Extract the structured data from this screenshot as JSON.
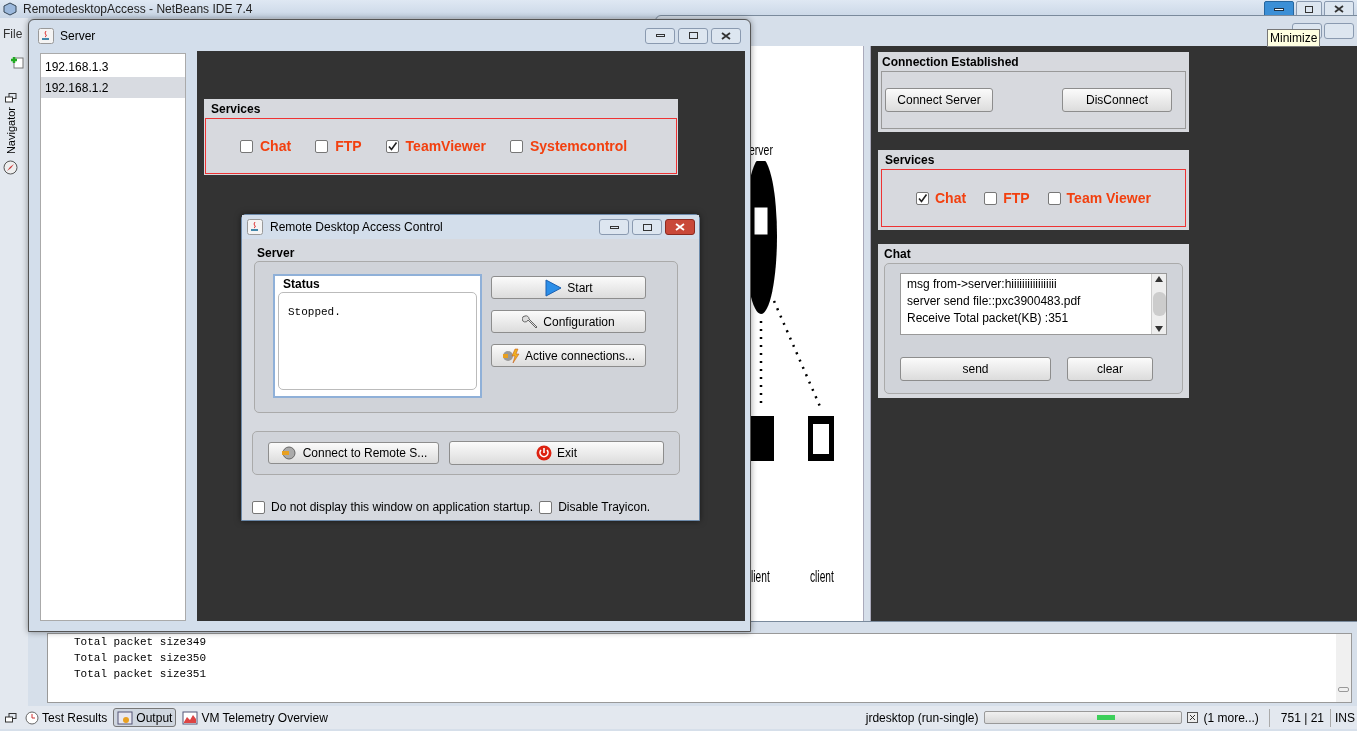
{
  "ide": {
    "title": "RemotedesktopAccess - NetBeans IDE 7.4",
    "menu": [
      {
        "label": "File"
      }
    ],
    "side_tab": "Navigator",
    "tooltip": "Minimize",
    "output_lines": [
      "Total packet size349",
      "Total packet size350",
      "Total packet size351"
    ],
    "bottom_tabs": [
      {
        "label": "Test Results",
        "selected": false
      },
      {
        "label": "Output",
        "selected": true
      },
      {
        "label": "VM Telemetry Overview",
        "selected": false
      }
    ],
    "status": {
      "task": "jrdesktop (run-single)",
      "more": "(1 more...)",
      "position": "751 | 21",
      "mode": "INS"
    }
  },
  "client_window": {
    "diagram_labels": [
      "erver",
      "lient",
      "client"
    ],
    "connection": {
      "title": "Connection Established",
      "buttons": [
        "Connect Server",
        "DisConnect"
      ]
    },
    "services": {
      "title": "Services",
      "options": [
        {
          "label": "Chat",
          "checked": true
        },
        {
          "label": "FTP",
          "checked": false
        },
        {
          "label": "Team Viewer",
          "checked": false
        }
      ]
    },
    "chat": {
      "title": "Chat",
      "log": [
        "msg from->server:hiiiiiiiiiiiiiiiii",
        "server send file::pxc3900483.pdf",
        "Receive Total packet(KB) :351"
      ],
      "buttons": [
        "send",
        "clear"
      ]
    }
  },
  "server_window": {
    "title": "Server",
    "hosts": [
      {
        "label": "192.168.1.3",
        "selected": false
      },
      {
        "label": "192.168.1.2",
        "selected": true
      }
    ],
    "services": {
      "title": "Services",
      "options": [
        {
          "label": "Chat",
          "checked": false
        },
        {
          "label": "FTP",
          "checked": false
        },
        {
          "label": "TeamViewer",
          "checked": true
        },
        {
          "label": "Systemcontrol",
          "checked": false
        }
      ]
    }
  },
  "dialog": {
    "title": "Remote Desktop Access Control",
    "section": "Server",
    "status_title": "Status",
    "status_text": "Stopped.",
    "actions": [
      {
        "label": "Start"
      },
      {
        "label": "Configuration"
      },
      {
        "label": "Active connections..."
      }
    ],
    "bottom_buttons": [
      {
        "label": "Connect to Remote S..."
      },
      {
        "label": "Exit"
      }
    ],
    "options": [
      {
        "label": "Do not display this window on application startup.",
        "checked": false
      },
      {
        "label": "Disable Trayicon.",
        "checked": false
      }
    ]
  }
}
